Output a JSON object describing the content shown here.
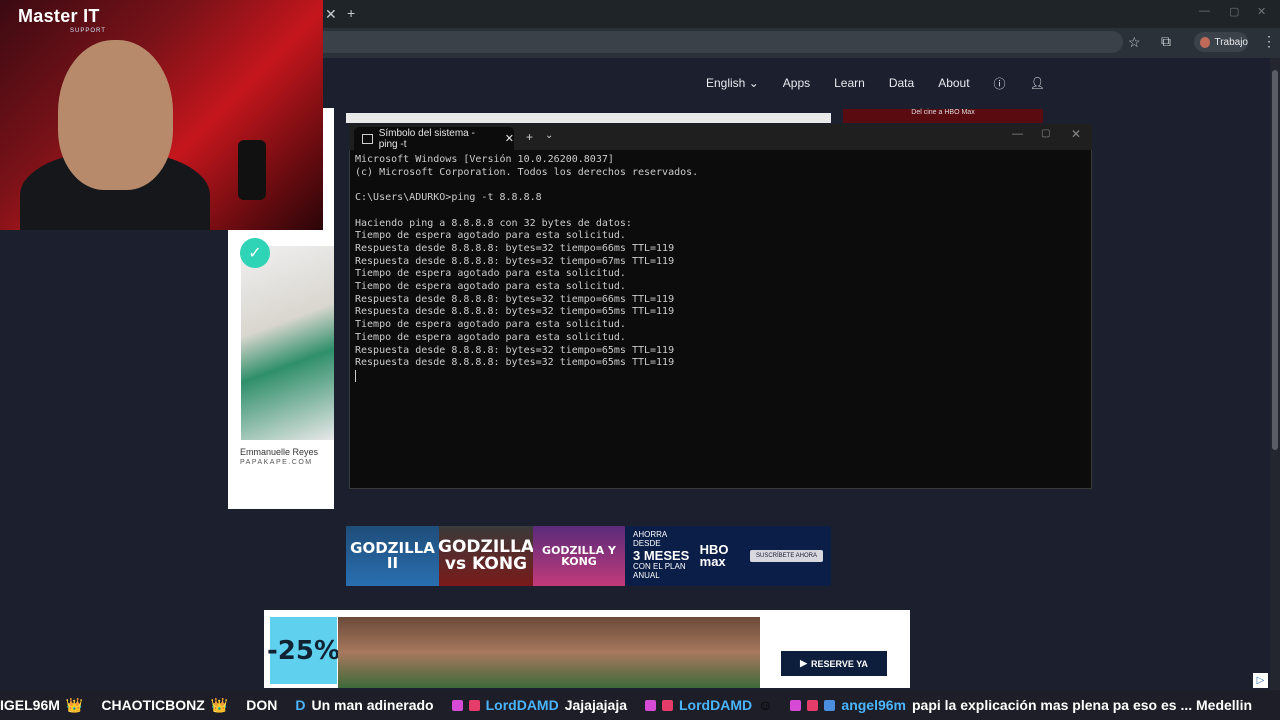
{
  "browser": {
    "new_tab_icon": "plus",
    "close_tab_icon": "close",
    "profile_label": "Trabajo"
  },
  "nav": {
    "language": "English",
    "items": [
      "Apps",
      "Learn",
      "Data",
      "About"
    ]
  },
  "overlay": {
    "logo": "Master IT",
    "logo_sub": "SUPPORT"
  },
  "left_ad": {
    "name": "Emmanuelle Reyes",
    "site": "PAPAKAPE.COM"
  },
  "terminal": {
    "tab_title": "Símbolo del sistema - ping  -t",
    "lines": [
      "Microsoft Windows [Versión 10.0.26200.8037]",
      "(c) Microsoft Corporation. Todos los derechos reservados.",
      "",
      "C:\\Users\\ADURKO>ping -t 8.8.8.8",
      "",
      "Haciendo ping a 8.8.8.8 con 32 bytes de datos:",
      "Tiempo de espera agotado para esta solicitud.",
      "Respuesta desde 8.8.8.8: bytes=32 tiempo=66ms TTL=119",
      "Respuesta desde 8.8.8.8: bytes=32 tiempo=67ms TTL=119",
      "Tiempo de espera agotado para esta solicitud.",
      "Tiempo de espera agotado para esta solicitud.",
      "Respuesta desde 8.8.8.8: bytes=32 tiempo=66ms TTL=119",
      "Respuesta desde 8.8.8.8: bytes=32 tiempo=65ms TTL=119",
      "Tiempo de espera agotado para esta solicitud.",
      "Tiempo de espera agotado para esta solicitud.",
      "Respuesta desde 8.8.8.8: bytes=32 tiempo=65ms TTL=119",
      "Respuesta desde 8.8.8.8: bytes=32 tiempo=65ms TTL=119"
    ]
  },
  "hbo_ad": {
    "poster1": "GODZILLA II",
    "poster2": "GODZILLA vs KONG",
    "poster3": "GODZILLA Y KONG",
    "offer_top": "AHORRA DESDE",
    "offer_big": "3 MESES",
    "offer_bottom": "CON EL PLAN ANUAL",
    "brand": "HBO max",
    "cta": "SUSCRÍBETE AHORA",
    "top_strip": "Del cine a HBO Max"
  },
  "bottom_ad": {
    "discount": "-25%",
    "cta": "RESERVE YA"
  },
  "ticker": {
    "s1": "IGEL96M",
    "s2": "CHAOTICBONZ",
    "s3": "DON",
    "s4_user": "D",
    "s4_msg": "Un man adinerado",
    "s5_user": "LordDAMD",
    "s5_msg": "Jajajajaja",
    "s6_user": "LordDAMD",
    "s7_user": "angel96m",
    "s7_msg": "papi la explicación mas plena pa eso es ... Medellin"
  }
}
